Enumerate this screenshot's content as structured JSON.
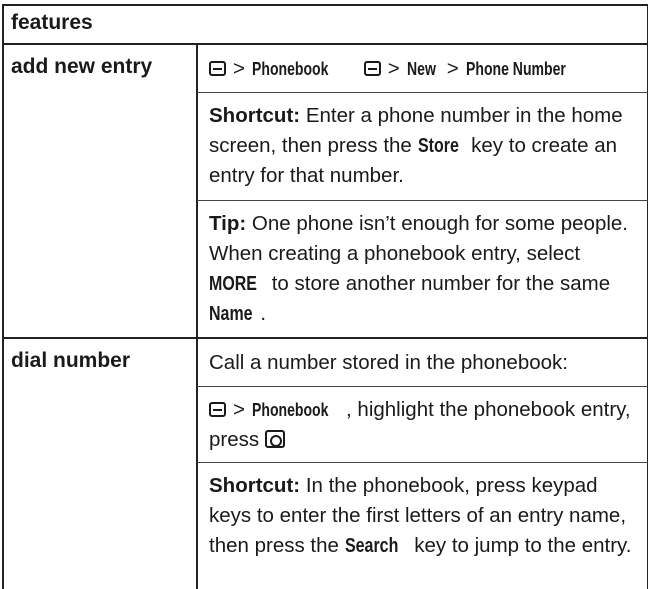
{
  "table": {
    "header": "features",
    "rows": [
      {
        "term": "add new entry",
        "path": {
          "sep": ">",
          "phonebook": "Phonebook",
          "new": "New",
          "phone_number": "Phone Number"
        },
        "shortcut": {
          "label": "Shortcut:",
          "text_before": "Enter a phone number in the home screen, then press the",
          "key": "Store",
          "text_after": "key to create an entry for that number."
        },
        "tip": {
          "label": "Tip:",
          "text_before": "One phone isn’t enough for some people. When creating a phonebook entry, select",
          "more": "MORE",
          "text_mid": "to store another number for the same",
          "name": "Name",
          "text_after": "."
        }
      },
      {
        "term": "dial number",
        "intro": "Call a number stored in the phonebook:",
        "path": {
          "sep": ">",
          "phonebook": "Phonebook",
          "text_after": ", highlight the phonebook entry, press"
        },
        "shortcut": {
          "label": "Shortcut:",
          "text_before": "In the phonebook, press keypad keys to enter the first letters of an entry name, then press the",
          "key": "Search",
          "text_after": "key to jump to the entry."
        }
      }
    ]
  },
  "icons": {
    "menu": "menu-key-icon",
    "send": "send-key-icon"
  }
}
